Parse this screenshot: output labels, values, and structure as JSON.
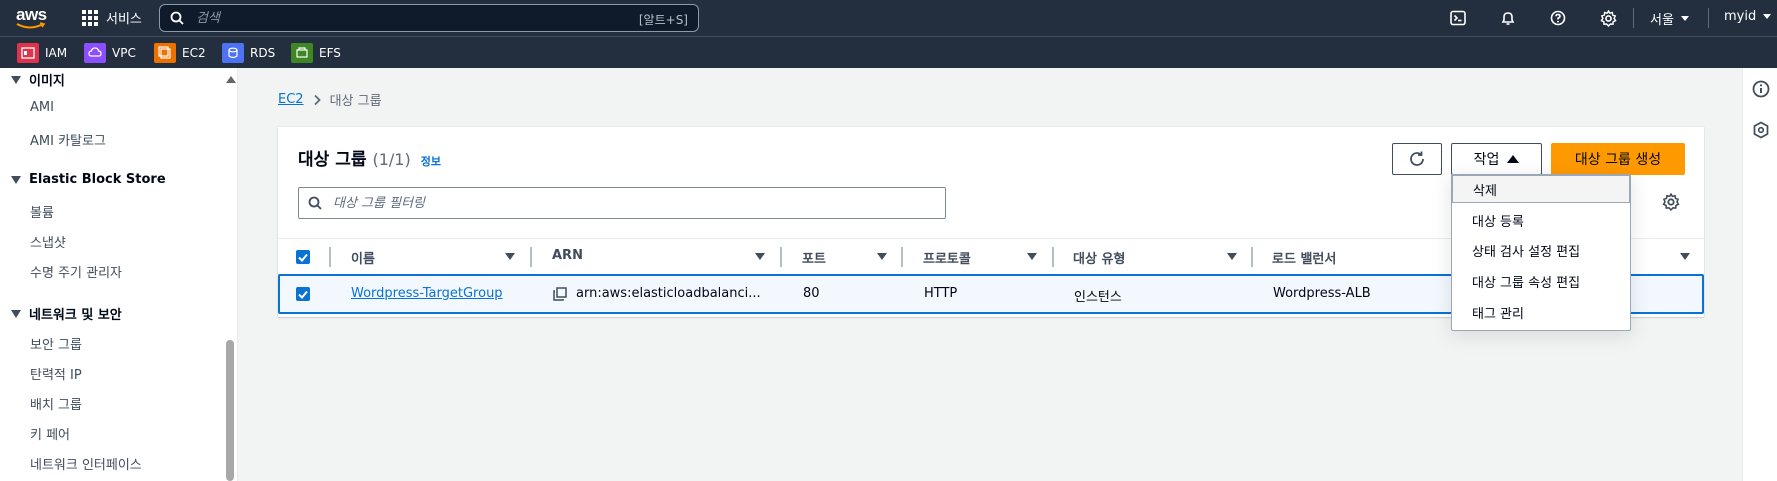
{
  "topnav": {
    "logo_text": "aws",
    "services_label": "서비스",
    "search_placeholder": "검색",
    "search_shortcut": "[알트+S]",
    "region": "서울",
    "account": "myid"
  },
  "favorites": [
    {
      "label": "IAM",
      "color": "#dd344c"
    },
    {
      "label": "VPC",
      "color": "#8c4fff"
    },
    {
      "label": "EC2",
      "color": "#ed7100"
    },
    {
      "label": "RDS",
      "color": "#4d72f3"
    },
    {
      "label": "EFS",
      "color": "#3f8624"
    }
  ],
  "sidebar": {
    "section_images": "이미지",
    "images_items": [
      "AMI",
      "AMI 카탈로그"
    ],
    "section_ebs": "Elastic Block Store",
    "ebs_items": [
      "볼륨",
      "스냅샷",
      "수명 주기 관리자"
    ],
    "section_network": "네트워크 및 보안",
    "network_items": [
      "보안 그룹",
      "탄력적 IP",
      "배치 그룹",
      "키 페어",
      "네트워크 인터페이스"
    ]
  },
  "breadcrumb": {
    "root": "EC2",
    "current": "대상 그룹"
  },
  "container": {
    "title": "대상 그룹",
    "count": "(1/1)",
    "info": "정보",
    "actions_label": "작업",
    "create_label": "대상 그룹 생성",
    "filter_placeholder": "대상 그룹 필터링"
  },
  "table": {
    "columns": [
      "이름",
      "ARN",
      "포트",
      "프로토콜",
      "대상 유형",
      "로드 밸런서"
    ],
    "rows": [
      {
        "name": "Wordpress-TargetGroup",
        "arn": "arn:aws:elasticloadbalanci...",
        "port": "80",
        "protocol": "HTTP",
        "target_type": "인스턴스",
        "load_balancer": "Wordpress-ALB"
      }
    ]
  },
  "actions_menu": [
    "삭제",
    "대상 등록",
    "상태 검사 설정 편집",
    "대상 그룹 속성 편집",
    "태그 관리"
  ]
}
